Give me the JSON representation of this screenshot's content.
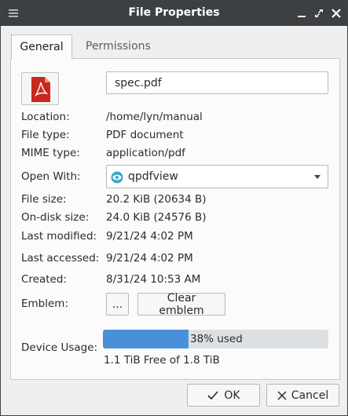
{
  "window": {
    "title": "File Properties"
  },
  "tabs": [
    {
      "label": "General"
    },
    {
      "label": "Permissions"
    }
  ],
  "file": {
    "name": "spec.pdf",
    "icon": "pdf-file-icon"
  },
  "fields": {
    "location": {
      "label": "Location:",
      "value": "/home/lyn/manual"
    },
    "file_type": {
      "label": "File type:",
      "value": "PDF document"
    },
    "mime_type": {
      "label": "MIME type:",
      "value": "application/pdf"
    },
    "open_with": {
      "label": "Open With:",
      "value": "qpdfview"
    },
    "file_size": {
      "label": "File size:",
      "value": "20.2 KiB (20634 B)"
    },
    "on_disk_size": {
      "label": "On-disk size:",
      "value": "24.0 KiB (24576 B)"
    },
    "last_modified": {
      "label": "Last modified:",
      "value": "9/21/24 4:02 PM"
    },
    "last_accessed": {
      "label": "Last accessed:",
      "value": "9/21/24 4:02 PM"
    },
    "created": {
      "label": "Created:",
      "value": "8/31/24 10:53 AM"
    },
    "emblem": {
      "label": "Emblem:",
      "choose_label": "...",
      "clear_label": "Clear emblem"
    }
  },
  "device_usage": {
    "label": "Device Usage:",
    "used_fraction": 0.38,
    "used_text": "38% used",
    "free_text": "1.1 TiB Free of 1.8 TiB"
  },
  "buttons": {
    "ok": "OK",
    "cancel": "Cancel"
  },
  "colors": {
    "titlebar": "#3c4043",
    "progress_fill": "#4a90d9",
    "pdf_red": "#c8281d",
    "app_icon": "#3fa7c8"
  }
}
